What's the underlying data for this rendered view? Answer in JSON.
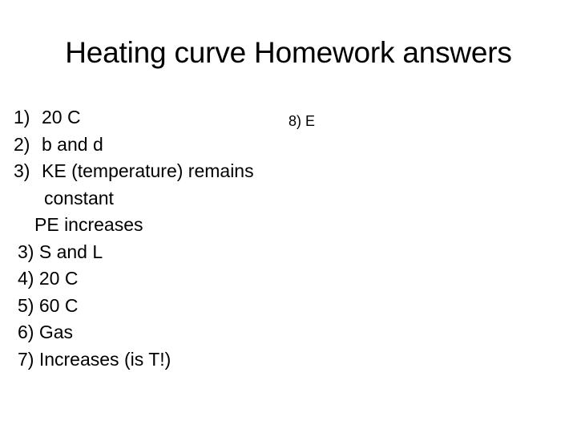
{
  "slide": {
    "title": "Heating curve Homework answers",
    "background_color": "#ffffff",
    "text_color": "#000000"
  },
  "left_column": {
    "numbered_items": [
      {
        "marker": "1)",
        "text": "20 C"
      },
      {
        "marker": "2)",
        "text": "b and d"
      },
      {
        "marker": "3)",
        "text": "KE (temperature) remains"
      }
    ],
    "continuation_line": "constant",
    "indented_line": "PE increases",
    "plain_lines": [
      "3) S and L",
      "4) 20 C",
      "5) 60 C",
      "6) Gas",
      "7) Increases (is T!)"
    ]
  },
  "right_column": {
    "lines": [
      "8) E"
    ]
  }
}
